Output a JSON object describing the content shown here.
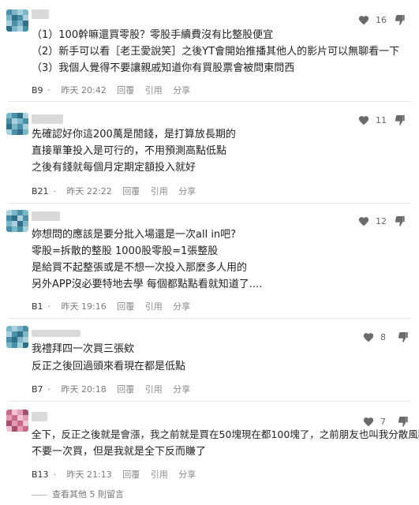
{
  "comments": [
    {
      "lines": [
        "（1）100幹嘛還買零股？零股手續費沒有比整股便宜",
        "（2）新手可以看［老王愛說笑］之後YT會開始推播其他人的影片可以無聊看一下",
        "（3）我個人覺得不要讓親戚知道你有買股票會被問東問西"
      ],
      "floor": "B9",
      "time": "昨天 20:42",
      "reply": "回覆",
      "quote": "引用",
      "share": "分享",
      "likes": "16"
    },
    {
      "lines": [
        "先確認好你這200萬是閒錢，是打算放長期的",
        "直接單筆投入是可行的，不用預測高點低點",
        "之後有錢就每個月定期定額投入就好"
      ],
      "floor": "B21",
      "time": "昨天 22:22",
      "reply": "回覆",
      "quote": "引用",
      "share": "分享",
      "likes": "11"
    },
    {
      "lines": [
        "妳想問的應該是要分批入場還是一次all in吧?",
        "零股=拆散的整股 1000股零股=1張整股",
        "是給買不起整張或是不想一次投入那麼多人用的",
        "另外APP沒必要特地去學 每個都點點看就知道了...."
      ],
      "floor": "B1",
      "time": "昨天 19:16",
      "reply": "回覆",
      "quote": "引用",
      "share": "分享",
      "likes": "12"
    },
    {
      "lines": [
        "我禮拜四一次買三張欸",
        "反正之後回過頭來看現在都是低點"
      ],
      "floor": "B7",
      "time": "昨天 20:18",
      "reply": "回覆",
      "quote": "引用",
      "share": "分享",
      "likes": "8"
    },
    {
      "lines": [
        "全下，反正之後就是會漲，我之前就是買在50塊現在都100塊了，之前朋友也叫我分散風險",
        "不要一次買，但是我就是全下反而賺了"
      ],
      "floor": "B13",
      "time": "昨天 21:13",
      "reply": "回覆",
      "quote": "引用",
      "share": "分享",
      "likes": "7"
    }
  ],
  "more_replies": "查看其他 5 則留言",
  "colors": {
    "icon": "#6b6b6b",
    "avatar_teal": [
      "#4a8fa8",
      "#7ab6c8",
      "#a9d0dc",
      "#2f6f87"
    ],
    "avatar_pink": [
      "#c96a8a",
      "#e39ab3",
      "#f2c4d3",
      "#a84f70"
    ]
  },
  "icons": {
    "like": "heart-icon",
    "dislike": "thumbs-down-icon"
  }
}
